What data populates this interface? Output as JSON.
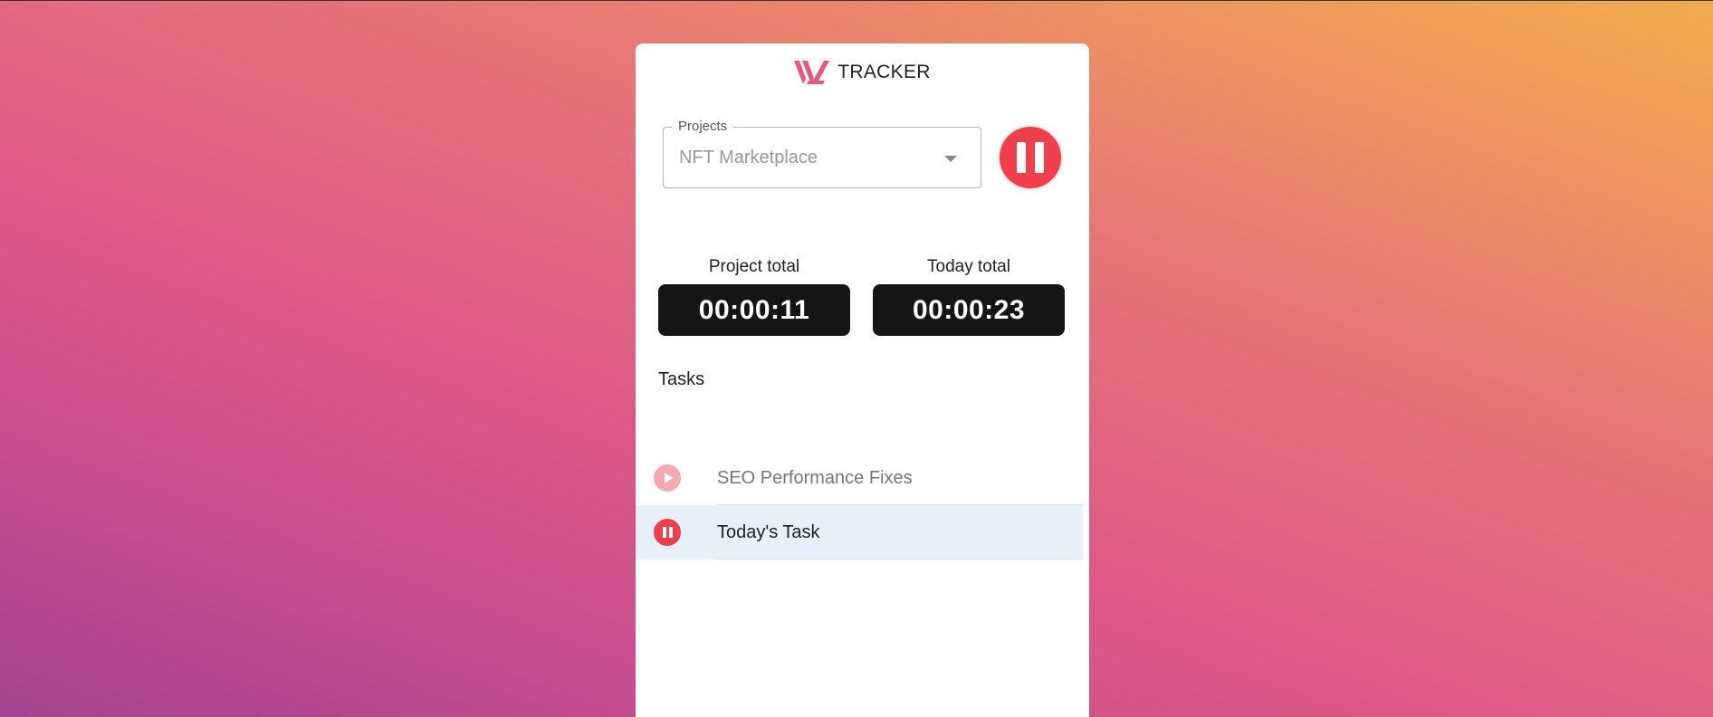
{
  "app": {
    "brand_name": "TRACKER",
    "accent_color": "#f03e4a"
  },
  "projects": {
    "label": "Projects",
    "selected": "NFT Marketplace",
    "control_icon": "pause-icon"
  },
  "totals": {
    "project_label": "Project total",
    "project_value": "00:00:11",
    "today_label": "Today total",
    "today_value": "00:00:23"
  },
  "tasks": {
    "title": "Tasks",
    "items": [
      {
        "name": "SEO Performance Fixes",
        "state": "idle",
        "icon": "play-icon"
      },
      {
        "name": "Today's Task",
        "state": "running",
        "icon": "pause-icon"
      }
    ]
  }
}
